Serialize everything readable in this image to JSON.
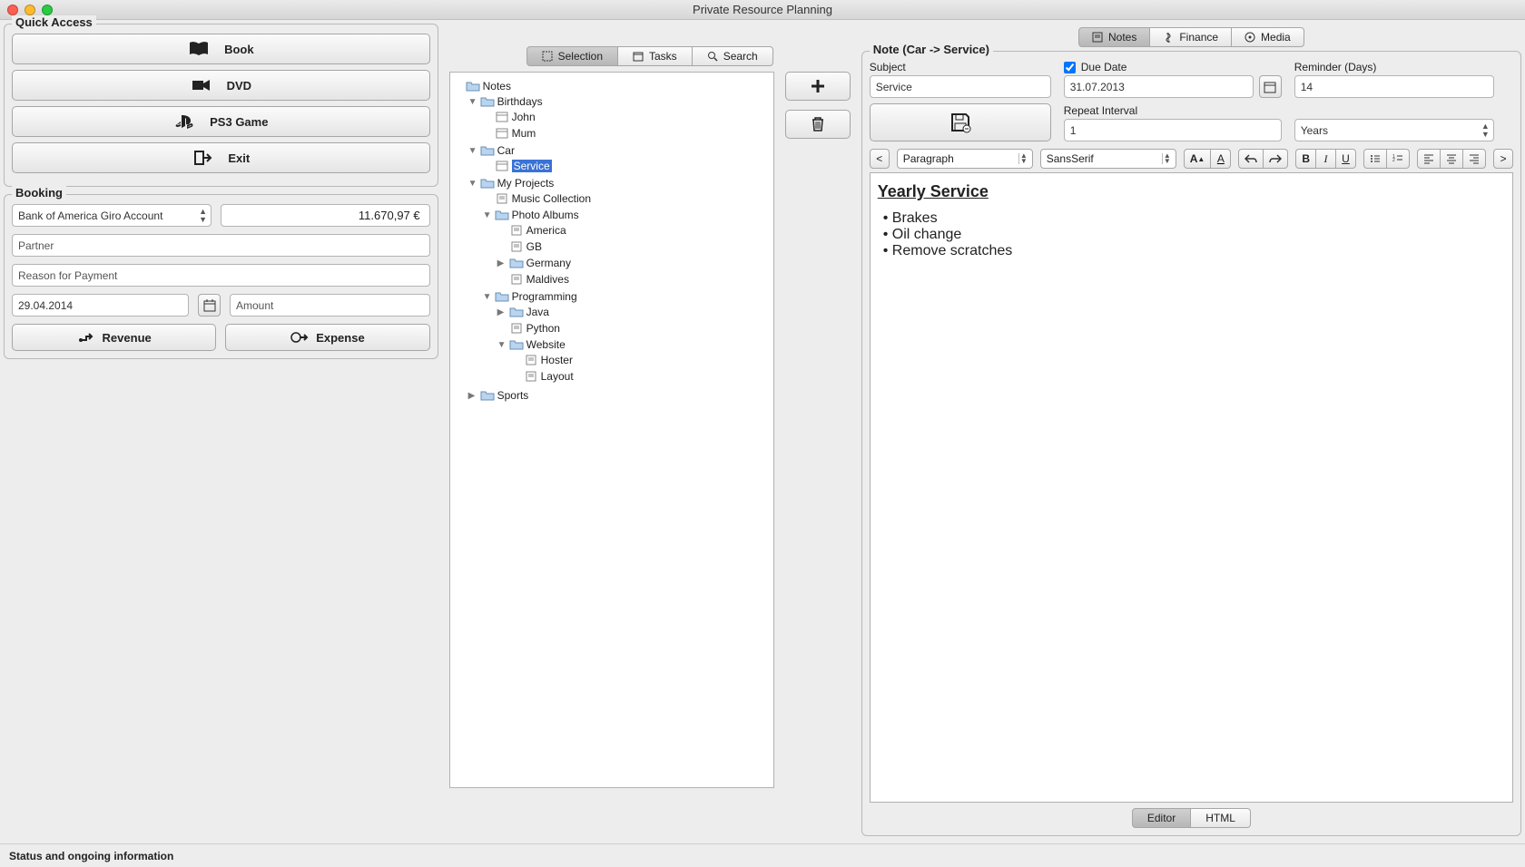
{
  "window": {
    "title": "Private Resource Planning"
  },
  "quickAccess": {
    "legend": "Quick Access",
    "buttons": {
      "book": "Book",
      "dvd": "DVD",
      "ps3": "PS3 Game",
      "exit": "Exit"
    }
  },
  "booking": {
    "legend": "Booking",
    "account": "Bank of America Giro Account",
    "balance": "11.670,97 €",
    "partner_ph": "Partner",
    "reason_ph": "Reason for Payment",
    "date": "29.04.2014",
    "amount_ph": "Amount",
    "revenue": "Revenue",
    "expense": "Expense"
  },
  "centerTabs": {
    "selection": "Selection",
    "tasks": "Tasks",
    "search": "Search"
  },
  "tree": {
    "root": "Notes",
    "birthdays": "Birthdays",
    "john": "John",
    "mum": "Mum",
    "car": "Car",
    "service": "Service",
    "myprojects": "My Projects",
    "music": "Music Collection",
    "photoalbums": "Photo Albums",
    "america": "America",
    "gb": "GB",
    "germany": "Germany",
    "maldives": "Maldives",
    "programming": "Programming",
    "java": "Java",
    "python": "Python",
    "website": "Website",
    "hoster": "Hoster",
    "layout": "Layout",
    "sports": "Sports"
  },
  "topTabs": {
    "notes": "Notes",
    "finance": "Finance",
    "media": "Media"
  },
  "note": {
    "legend": "Note (Car -> Service)",
    "subject_lbl": "Subject",
    "subject_val": "Service",
    "duedate_lbl": "Due Date",
    "duedate_val": "31.07.2013",
    "reminder_lbl": "Reminder (Days)",
    "reminder_val": "14",
    "repeat_lbl": "Repeat Interval",
    "repeat_val": "1",
    "repeat_unit": "Years"
  },
  "editorToolbar": {
    "prev": "<",
    "paragraph": "Paragraph",
    "font": "SansSerif",
    "next": ">"
  },
  "editorContent": {
    "heading": "Yearly Service",
    "item1": "Brakes",
    "item2": "Oil change",
    "item3": "Remove scratches"
  },
  "viewTabs": {
    "editor": "Editor",
    "html": "HTML"
  },
  "status": "Status and ongoing information"
}
